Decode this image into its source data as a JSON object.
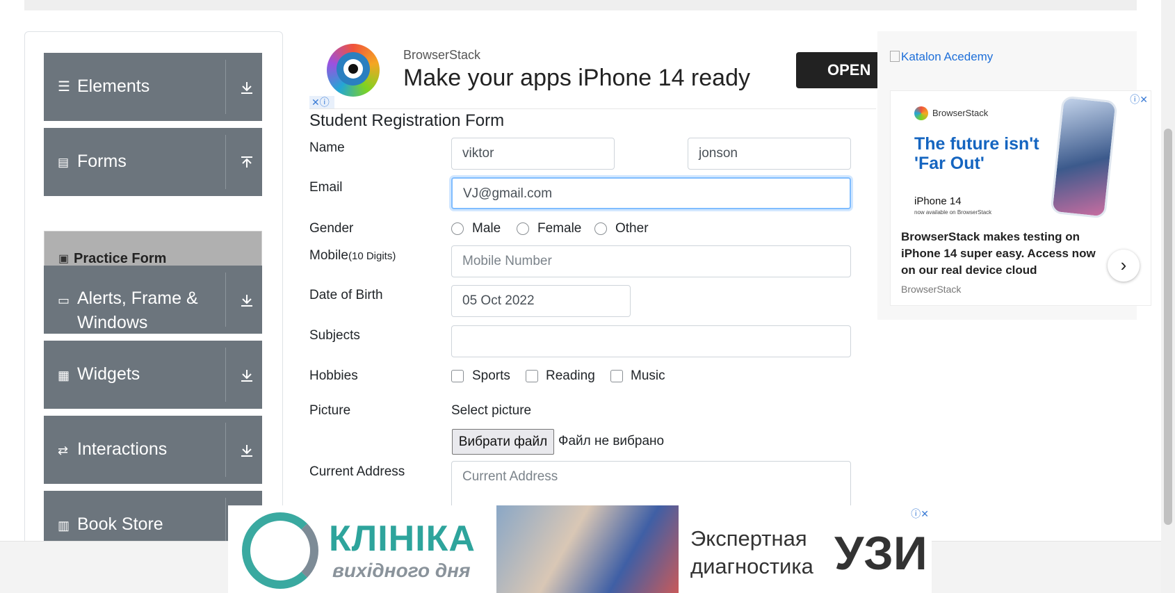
{
  "sidebar": {
    "groups": [
      {
        "label": "Elements",
        "icon": "list-icon",
        "arrow": "down"
      },
      {
        "label": "Forms",
        "icon": "document-icon",
        "arrow": "up"
      },
      {
        "label": "Alerts, Frame &",
        "label2": "Windows",
        "icon": "window-icon",
        "arrow": "down"
      },
      {
        "label": "Widgets",
        "icon": "widgets-icon",
        "arrow": "down"
      },
      {
        "label": "Interactions",
        "icon": "interactions-icon",
        "arrow": "down"
      },
      {
        "label": "Book Store",
        "icon": "books-icon",
        "arrow": "down"
      }
    ],
    "active_sub_item": "Practice Form"
  },
  "top_ad": {
    "brand": "BrowserStack",
    "headline": "Make your apps iPhone 14 ready",
    "cta": "OPEN"
  },
  "form": {
    "title": "Student Registration Form",
    "name_label": "Name",
    "first_name": "viktor",
    "last_name": "jonson",
    "email_label": "Email",
    "email": "VJ@gmail.com",
    "gender_label": "Gender",
    "gender_options": [
      "Male",
      "Female",
      "Other"
    ],
    "mobile_label": "Mobile",
    "mobile_hint": "(10 Digits)",
    "mobile_placeholder": "Mobile Number",
    "dob_label": "Date of Birth",
    "dob": "05 Oct 2022",
    "subjects_label": "Subjects",
    "hobbies_label": "Hobbies",
    "hobbies": [
      "Sports",
      "Reading",
      "Music"
    ],
    "picture_label": "Picture",
    "select_picture": "Select picture",
    "file_button": "Вибрати файл",
    "file_status": "Файл не вибрано",
    "address_label": "Current Address",
    "address_placeholder": "Current Address"
  },
  "right_ads": {
    "katalon_alt": "Katalon Acedemy",
    "bs_brand": "BrowserStack",
    "bs_headline": "The future isn't 'Far Out'",
    "bs_iphone": "iPhone 14",
    "bs_available": "now available on BrowserStack",
    "bs_desc": "BrowserStack makes testing on iPhone 14 super easy. Access now on our real device cloud",
    "bs_sub": "BrowserStack"
  },
  "bottom_ad": {
    "clinic": "КЛІНІКА",
    "weekend": "вихідного дня",
    "expert": "Экспертная диагностика",
    "uzi": "УЗИ"
  },
  "colors": {
    "sidebar_group_bg": "#6c757d",
    "active_item_bg": "#b0b0b0",
    "focus_border": "#80bdff",
    "link_blue": "#1e6fd9"
  }
}
